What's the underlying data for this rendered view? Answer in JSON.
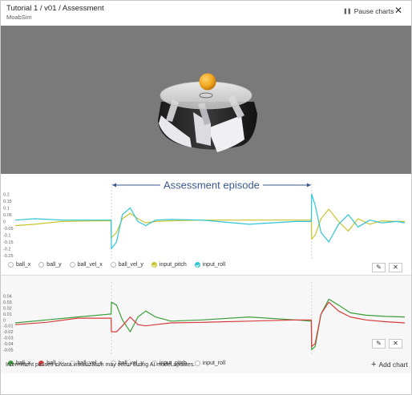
{
  "header": {
    "title": "Tutorial 1 / v01 / Assessment",
    "subtitle": "MoabSim",
    "pause_label": "Pause charts",
    "pause_icon": "pause-icon",
    "close_icon": "close-icon"
  },
  "annotation": {
    "label": "Assessment episode",
    "color": "#3a5a8c"
  },
  "charts": [
    {
      "legend": [
        {
          "label": "ball_x",
          "checked": false,
          "color": "#ffffff"
        },
        {
          "label": "ball_y",
          "checked": false,
          "color": "#ffffff"
        },
        {
          "label": "ball_vel_x",
          "checked": false,
          "color": "#ffffff"
        },
        {
          "label": "ball_vel_y",
          "checked": false,
          "color": "#ffffff"
        },
        {
          "label": "input_pitch",
          "checked": true,
          "color": "#c8c52c"
        },
        {
          "label": "input_roll",
          "checked": true,
          "color": "#2fc4d6"
        }
      ],
      "edit_icon": "pencil-icon",
      "remove_icon": "close-icon"
    },
    {
      "legend": [
        {
          "label": "ball_x",
          "checked": true,
          "color": "#3b9e3b"
        },
        {
          "label": "ball_y",
          "checked": true,
          "color": "#d83b3b"
        },
        {
          "label": "ball_vel_x",
          "checked": false,
          "color": "#ffffff"
        },
        {
          "label": "ball_vel_y",
          "checked": false,
          "color": "#ffffff"
        },
        {
          "label": "input_pitch",
          "checked": false,
          "color": "#ffffff"
        },
        {
          "label": "input_roll",
          "checked": false,
          "color": "#ffffff"
        }
      ],
      "edit_icon": "pencil-icon",
      "remove_icon": "close-icon"
    }
  ],
  "chart_data": [
    {
      "type": "line",
      "yticks": [
        "0.2",
        "0.15",
        "0.1",
        "0.05",
        "0",
        "-0.05",
        "-0.1",
        "-0.15",
        "-0.2",
        "-0.25"
      ],
      "ylim": [
        -0.25,
        0.22
      ],
      "xlim": [
        0,
        100
      ],
      "grid": false,
      "series": [
        {
          "name": "input_pitch",
          "color": "#c8c52c",
          "x": [
            0,
            5,
            12,
            20,
            24.6,
            24.7,
            26,
            27.5,
            29.5,
            31.5,
            33.5,
            36,
            40,
            48,
            60,
            72,
            76,
            76.1,
            77,
            78.5,
            80.5,
            83,
            85.5,
            88,
            91,
            94,
            98,
            100
          ],
          "y": [
            -0.03,
            -0.02,
            0.0,
            0.005,
            0.005,
            -0.12,
            -0.08,
            0.02,
            0.06,
            0.02,
            -0.01,
            0.0,
            0.005,
            0.01,
            0.01,
            0.01,
            0.01,
            -0.13,
            -0.1,
            0.02,
            0.09,
            0.0,
            -0.07,
            0.02,
            -0.02,
            0.005,
            0.0,
            0.0
          ]
        },
        {
          "name": "input_roll",
          "color": "#2fc4d6",
          "x": [
            0,
            5,
            12,
            20,
            24.6,
            24.7,
            26,
            27.5,
            29.5,
            31.5,
            33.5,
            36,
            40,
            48,
            60,
            72,
            76,
            76.1,
            77,
            78.5,
            80.5,
            83,
            85.5,
            88,
            91,
            94,
            98,
            100
          ],
          "y": [
            0.01,
            0.02,
            0.01,
            0.01,
            0.01,
            -0.2,
            -0.15,
            0.05,
            0.1,
            0.0,
            -0.03,
            0.01,
            0.015,
            0.01,
            -0.02,
            0.0,
            0.0,
            0.2,
            0.12,
            -0.08,
            -0.15,
            -0.02,
            0.05,
            -0.04,
            0.01,
            -0.01,
            0.0,
            -0.01
          ]
        }
      ]
    },
    {
      "type": "line",
      "yticks": [
        "0.04",
        "0.03",
        "0.02",
        "0.01",
        "0",
        "-0.01",
        "-0.02",
        "-0.03",
        "-0.04",
        "-0.05"
      ],
      "ylim": [
        -0.055,
        0.045
      ],
      "xlim": [
        0,
        100
      ],
      "grid": false,
      "series": [
        {
          "name": "ball_x",
          "color": "#3b9e3b",
          "x": [
            0,
            8,
            16,
            24.6,
            24.7,
            26,
            27.5,
            29.5,
            31.5,
            33.5,
            36,
            40,
            48,
            60,
            72,
            76,
            76.1,
            77,
            78.5,
            80.5,
            83,
            86,
            90,
            95,
            100
          ],
          "y": [
            -0.005,
            0.0,
            0.005,
            0.01,
            0.03,
            0.025,
            0.0,
            -0.02,
            0.005,
            0.015,
            0.005,
            -0.002,
            0.0,
            0.005,
            0.0,
            -0.002,
            -0.05,
            -0.045,
            0.01,
            0.035,
            0.025,
            0.012,
            0.008,
            0.006,
            0.005
          ]
        },
        {
          "name": "ball_y",
          "color": "#d83b3b",
          "x": [
            0,
            8,
            16,
            24.6,
            24.7,
            26,
            27.5,
            29.5,
            31.5,
            33.5,
            36,
            40,
            48,
            60,
            72,
            76,
            76.1,
            77,
            78.5,
            80.5,
            83,
            86,
            90,
            95,
            100
          ],
          "y": [
            -0.008,
            -0.004,
            0.003,
            0.003,
            -0.02,
            -0.02,
            -0.01,
            0.005,
            -0.008,
            -0.01,
            -0.008,
            -0.005,
            -0.004,
            -0.002,
            0.0,
            0.0,
            -0.045,
            -0.04,
            0.01,
            0.03,
            0.015,
            0.005,
            0.0,
            -0.003,
            -0.005
          ]
        }
      ]
    }
  ],
  "footer": {
    "note": "Intermittent pauses in data visualization may occur during AI model updates.",
    "add_chart_label": "Add chart",
    "add_chart_icon": "plus-icon"
  }
}
